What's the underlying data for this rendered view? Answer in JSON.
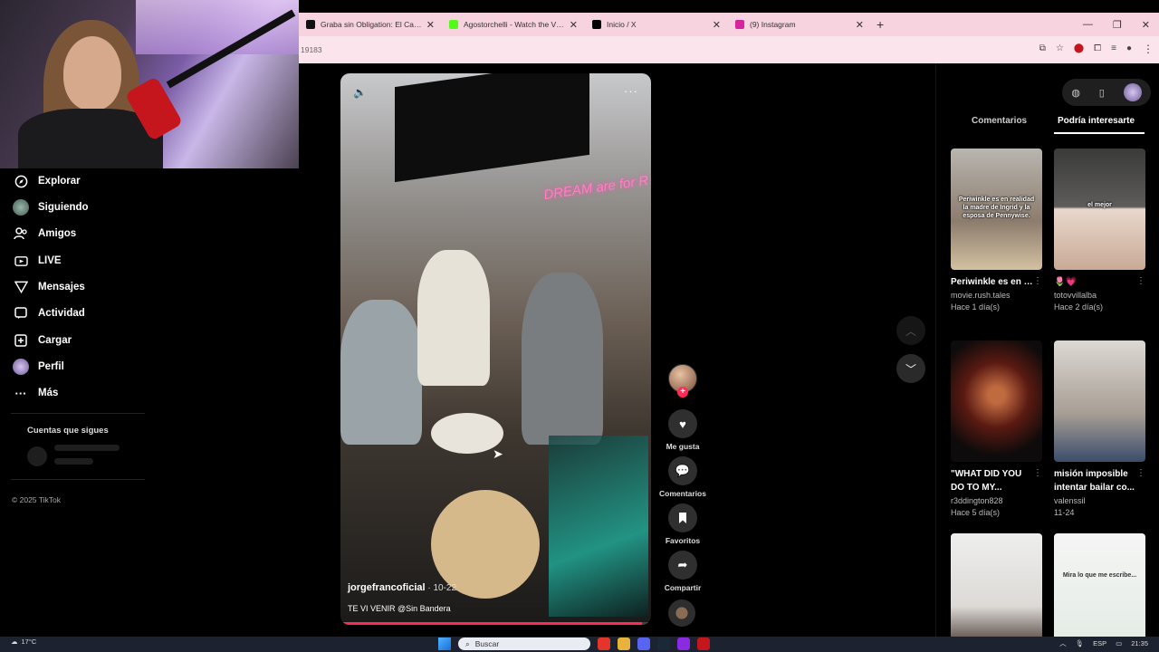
{
  "browser": {
    "tabs": [
      {
        "title": "Graba sin Obligation: El Caos d",
        "color": "#111111"
      },
      {
        "title": "Agostorchelli - Watch the VOD",
        "color": "#53fc18"
      },
      {
        "title": "Inicio / X",
        "color": "#000000"
      },
      {
        "title": "(9) Instagram",
        "color": "#d6249f"
      }
    ],
    "new_tab": "+",
    "address": "19183"
  },
  "sidebar": {
    "items": [
      {
        "label": "Explorar",
        "icon": "compass-icon",
        "glyph": "◎"
      },
      {
        "label": "Siguiendo",
        "icon": "following-avatar-icon",
        "glyph": ""
      },
      {
        "label": "Amigos",
        "icon": "friends-icon",
        "glyph": "👥"
      },
      {
        "label": "LIVE",
        "icon": "live-icon",
        "glyph": "▣"
      },
      {
        "label": "Mensajes",
        "icon": "messages-icon",
        "glyph": "▽"
      },
      {
        "label": "Actividad",
        "icon": "activity-icon",
        "glyph": "▢"
      },
      {
        "label": "Cargar",
        "icon": "upload-icon",
        "glyph": "⊞"
      },
      {
        "label": "Perfil",
        "icon": "profile-avatar-icon",
        "glyph": ""
      },
      {
        "label": "Más",
        "icon": "more-icon",
        "glyph": "⋯"
      }
    ],
    "following_accounts": "Cuentas que sigues",
    "copyright": "© 2025 TikTok"
  },
  "video": {
    "neon_text": "DREAM are for R",
    "author": "jorgefrancoficial",
    "date": " · 10-22",
    "caption": "TE VI VENIR @Sin Bandera",
    "progress": 0.97
  },
  "actions": {
    "follow": "+",
    "like": "Me gusta",
    "comments": "Comentarios",
    "favorites": "Favoritos",
    "share": "Compartir"
  },
  "right_panel": {
    "tab_comments": "Comentarios",
    "tab_interest": "Podría interesarte",
    "cards": [
      {
        "title": "Periwinkle es en realidad la madre...",
        "user": "movie.rush.tales",
        "date": "Hace 1 día(s)",
        "overlay": "Periwinkle es en realidad la madre de Ingrid y la esposa de Pennywise."
      },
      {
        "title": "🌷💗",
        "user": "totovvillalba",
        "date": "Hace 2 día(s)",
        "overlay": "el mejor"
      },
      {
        "title": "\"WHAT DID YOU DO TO MY...",
        "user": "r3ddington828",
        "date": "Hace 5 día(s)",
        "overlay": ""
      },
      {
        "title": "misión imposible intentar bailar co...",
        "user": "valenssil",
        "date": "11-24",
        "overlay": ""
      },
      {
        "title": "",
        "user": "",
        "date": "",
        "overlay": ""
      },
      {
        "title": "",
        "user": "",
        "date": "",
        "overlay": "Mira lo que me escribe..."
      }
    ]
  },
  "taskbar": {
    "temperature": "17°C",
    "search_placeholder": "Buscar",
    "lang": "ESP",
    "time": "21:35"
  }
}
